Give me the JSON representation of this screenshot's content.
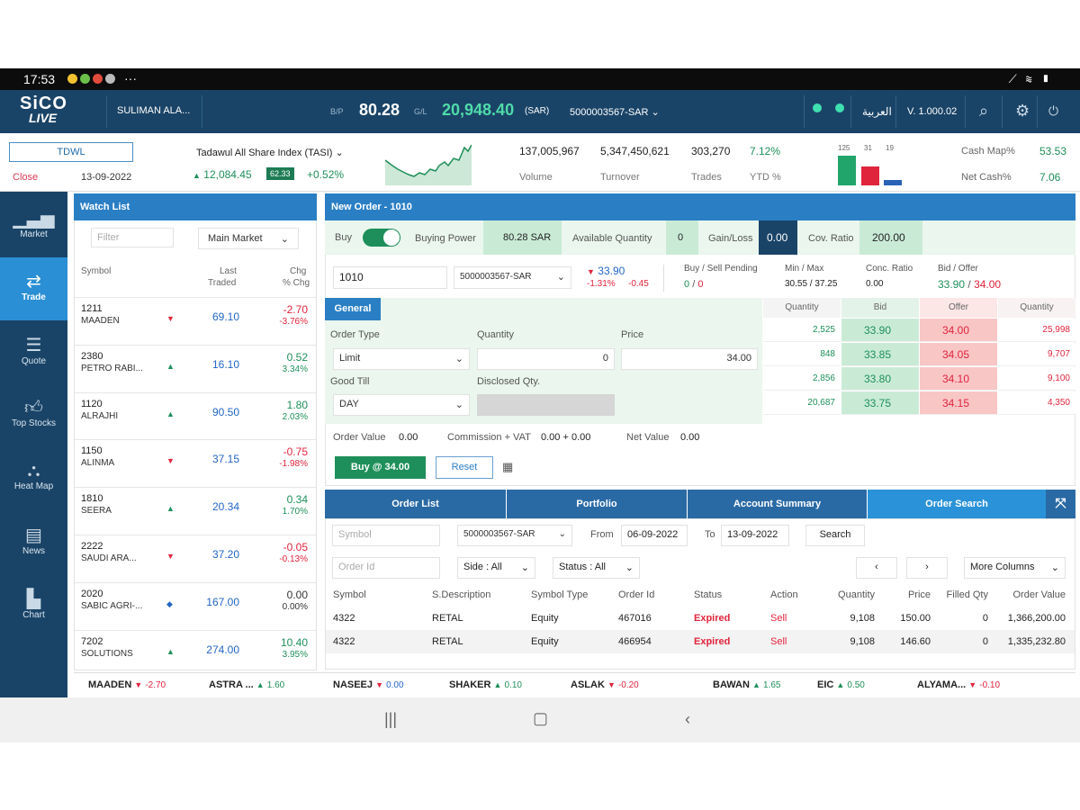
{
  "status_bar": {
    "time": "17:53",
    "dots": "···"
  },
  "header": {
    "logo_top": "SiCO",
    "logo_bottom": "LIVE",
    "user": "SULIMAN ALA...",
    "bp_label": "B/P",
    "bp_value": "80.28",
    "gl_label": "G/L",
    "gl_value": "20,948.40",
    "currency": "(SAR)",
    "account": "5000003567-SAR",
    "lang": "العربية",
    "version": "V. 1.000.02",
    "icons": [
      "search-icon",
      "gear-icon",
      "power-icon"
    ]
  },
  "index_bar": {
    "symbol": "TDWL",
    "close_label": "Close",
    "date": "13-09-2022",
    "index_name": "Tadawul All Share Index (TASI)",
    "index_value": "12,084.45",
    "badge": "62.33",
    "index_pct": "+0.52%",
    "volume": "137,005,967",
    "volume_label": "Volume",
    "turnover": "5,347,450,621",
    "turnover_label": "Turnover",
    "trades": "303,270",
    "trades_label": "Trades",
    "ytd": "7.12%",
    "ytd_label": "YTD %",
    "bar_labels": [
      "125",
      "31",
      "19"
    ],
    "cashmap_label": "Cash Map%",
    "cashmap_value": "53.53",
    "netcash_label": "Net Cash%",
    "netcash_value": "7.06"
  },
  "sidenav": [
    {
      "label": "Market",
      "icon": "bar-chart-icon"
    },
    {
      "label": "Trade",
      "icon": "swap-arrows-icon"
    },
    {
      "label": "Quote",
      "icon": "list-icon"
    },
    {
      "label": "Top Stocks",
      "icon": "thumbs-up-icon"
    },
    {
      "label": "Heat Map",
      "icon": "heat-map-icon"
    },
    {
      "label": "News",
      "icon": "news-icon"
    },
    {
      "label": "Chart",
      "icon": "chart-icon"
    }
  ],
  "watchlist": {
    "title": "Watch List",
    "filter_placeholder": "Filter",
    "market": "Main Market",
    "col_symbol": "Symbol",
    "col_last_1": "Last",
    "col_last_2": "Traded",
    "col_chg_1": "Chg",
    "col_chg_2": "% Chg",
    "rows": [
      {
        "code": "1211",
        "name": "MAADEN",
        "last": "69.10",
        "chg": "-2.70",
        "pct": "-3.76%",
        "dir": "dn"
      },
      {
        "code": "2380",
        "name": "PETRO RABI...",
        "last": "16.10",
        "chg": "0.52",
        "pct": "3.34%",
        "dir": "up"
      },
      {
        "code": "1120",
        "name": "ALRAJHI",
        "last": "90.50",
        "chg": "1.80",
        "pct": "2.03%",
        "dir": "up"
      },
      {
        "code": "1150",
        "name": "ALINMA",
        "last": "37.15",
        "chg": "-0.75",
        "pct": "-1.98%",
        "dir": "dn"
      },
      {
        "code": "1810",
        "name": "SEERA",
        "last": "20.34",
        "chg": "0.34",
        "pct": "1.70%",
        "dir": "up"
      },
      {
        "code": "2222",
        "name": "SAUDI ARA...",
        "last": "37.20",
        "chg": "-0.05",
        "pct": "-0.13%",
        "dir": "dn"
      },
      {
        "code": "2020",
        "name": "SABIC AGRI-...",
        "last": "167.00",
        "chg": "0.00",
        "pct": "0.00%",
        "dir": "nu"
      },
      {
        "code": "7202",
        "name": "SOLUTIONS",
        "last": "274.00",
        "chg": "10.40",
        "pct": "3.95%",
        "dir": "up"
      }
    ]
  },
  "order": {
    "title": "New Order - 1010",
    "buy_label": "Buy",
    "buying_power_label": "Buying Power",
    "buying_power": "80.28 SAR",
    "avail_qty_label": "Available Quantity",
    "avail_qty": "0",
    "gainloss_label": "Gain/Loss",
    "gainloss": "0.00",
    "cov_label": "Cov. Ratio",
    "cov": "200.00",
    "symbol": "1010",
    "account": "5000003567-SAR",
    "price": "33.90",
    "price_chg": "-1.31%",
    "price_chg2": "-0.45",
    "pending_label": "Buy / Sell Pending",
    "pending_buy": "0",
    "pending_sep": "/",
    "pending_sell": "0",
    "minmax_label": "Min / Max",
    "minmax": "30.55 / 37.25",
    "conc_label": "Conc. Ratio",
    "conc": "0.00",
    "bidoffer_label": "Bid / Offer",
    "bid": "33.90",
    "bidoffer_sep": "/",
    "offer": "34.00",
    "general_tab": "General",
    "order_type_label": "Order Type",
    "order_type": "Limit",
    "quantity_label": "Quantity",
    "quantity": "0",
    "price_label": "Price",
    "price_input": "34.00",
    "good_till_label": "Good Till",
    "good_till": "DAY",
    "disclosed_label": "Disclosed Qty.",
    "order_value_label": "Order Value",
    "order_value": "0.00",
    "commission_label": "Commission + VAT",
    "commission": "0.00 + 0.00",
    "net_value_label": "Net Value",
    "net_value": "0.00",
    "buy_button": "Buy @ 34.00",
    "reset_button": "Reset"
  },
  "depth": {
    "headers": [
      "Quantity",
      "Bid",
      "Offer",
      "Quantity"
    ],
    "rows": [
      {
        "bq": "2,525",
        "bid": "33.90",
        "offer": "34.00",
        "oq": "25,998"
      },
      {
        "bq": "848",
        "bid": "33.85",
        "offer": "34.05",
        "oq": "9,707"
      },
      {
        "bq": "2,856",
        "bid": "33.80",
        "offer": "34.10",
        "oq": "9,100"
      },
      {
        "bq": "20,687",
        "bid": "33.75",
        "offer": "34.15",
        "oq": "4,350"
      }
    ]
  },
  "bottom_tabs": [
    "Order List",
    "Portfolio",
    "Account Summary",
    "Order Search"
  ],
  "search": {
    "symbol_placeholder": "Symbol",
    "account": "5000003567-SAR",
    "from_label": "From",
    "from": "06-09-2022",
    "to_label": "To",
    "to": "13-09-2022",
    "search_button": "Search",
    "orderid_placeholder": "Order Id",
    "side": "Side : All",
    "status": "Status : All",
    "prev": "‹",
    "next": "›",
    "more": "More Columns"
  },
  "orders_table": {
    "headers": [
      "Symbol",
      "S.Description",
      "Symbol Type",
      "Order Id",
      "Status",
      "Action",
      "Quantity",
      "Price",
      "Filled Qty",
      "Order Value"
    ],
    "rows": [
      [
        "4322",
        "RETAL",
        "Equity",
        "467016",
        "Expired",
        "Sell",
        "9,108",
        "150.00",
        "0",
        "1,366,200.00"
      ],
      [
        "4322",
        "RETAL",
        "Equity",
        "466954",
        "Expired",
        "Sell",
        "9,108",
        "146.60",
        "0",
        "1,335,232.80"
      ]
    ]
  },
  "ticker": [
    {
      "name": "MAADEN",
      "val": "-2.70",
      "dir": "dn"
    },
    {
      "name": "ASTRA ...",
      "val": "1.60",
      "dir": "up"
    },
    {
      "name": "NASEEJ",
      "val": "0.00",
      "dir": "nu"
    },
    {
      "name": "SHAKER",
      "val": "0.10",
      "dir": "up"
    },
    {
      "name": "ASLAK",
      "val": "-0.20",
      "dir": "dn"
    },
    {
      "name": "BAWAN",
      "val": "1.65",
      "dir": "up"
    },
    {
      "name": "EIC",
      "val": "0.50",
      "dir": "up"
    },
    {
      "name": "ALYAMA...",
      "val": "-0.10",
      "dir": "dn"
    }
  ],
  "colors": {
    "header": "#1a4467",
    "accent": "#2a7fc4",
    "up": "#1e8f5a",
    "down": "#e0243c"
  }
}
